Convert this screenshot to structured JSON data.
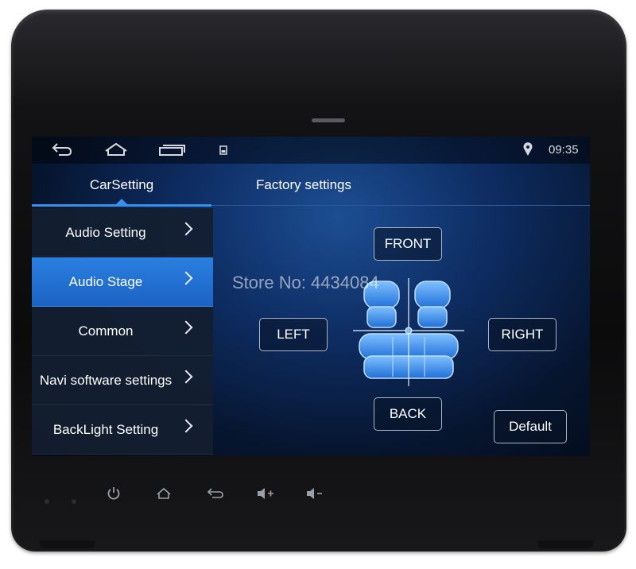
{
  "statusbar": {
    "time": "09:35",
    "nav_icons": [
      "back-icon",
      "home-icon",
      "recent-apps-icon",
      "screenshot-icon"
    ],
    "location_icon": "location-pin-icon"
  },
  "tabs": [
    {
      "label": "CarSetting",
      "active": true
    },
    {
      "label": "Factory settings",
      "active": false
    }
  ],
  "menu": {
    "items": [
      {
        "label": "Audio Setting",
        "active": false
      },
      {
        "label": "Audio Stage",
        "active": true
      },
      {
        "label": "Common",
        "active": false
      },
      {
        "label": "Navi software settings",
        "active": false
      },
      {
        "label": "BackLight Setting",
        "active": false
      }
    ]
  },
  "stage": {
    "front_label": "FRONT",
    "back_label": "BACK",
    "left_label": "LEFT",
    "right_label": "RIGHT",
    "default_label": "Default"
  },
  "watermark": "Store No: 4434084",
  "hardware_buttons": [
    "power-icon",
    "home-icon",
    "back-icon",
    "volume-up-icon",
    "volume-down-icon"
  ],
  "colors": {
    "accent": "#3b8fe8",
    "active_menu": "#2a7fe0",
    "seat": "#3a8ff0"
  }
}
